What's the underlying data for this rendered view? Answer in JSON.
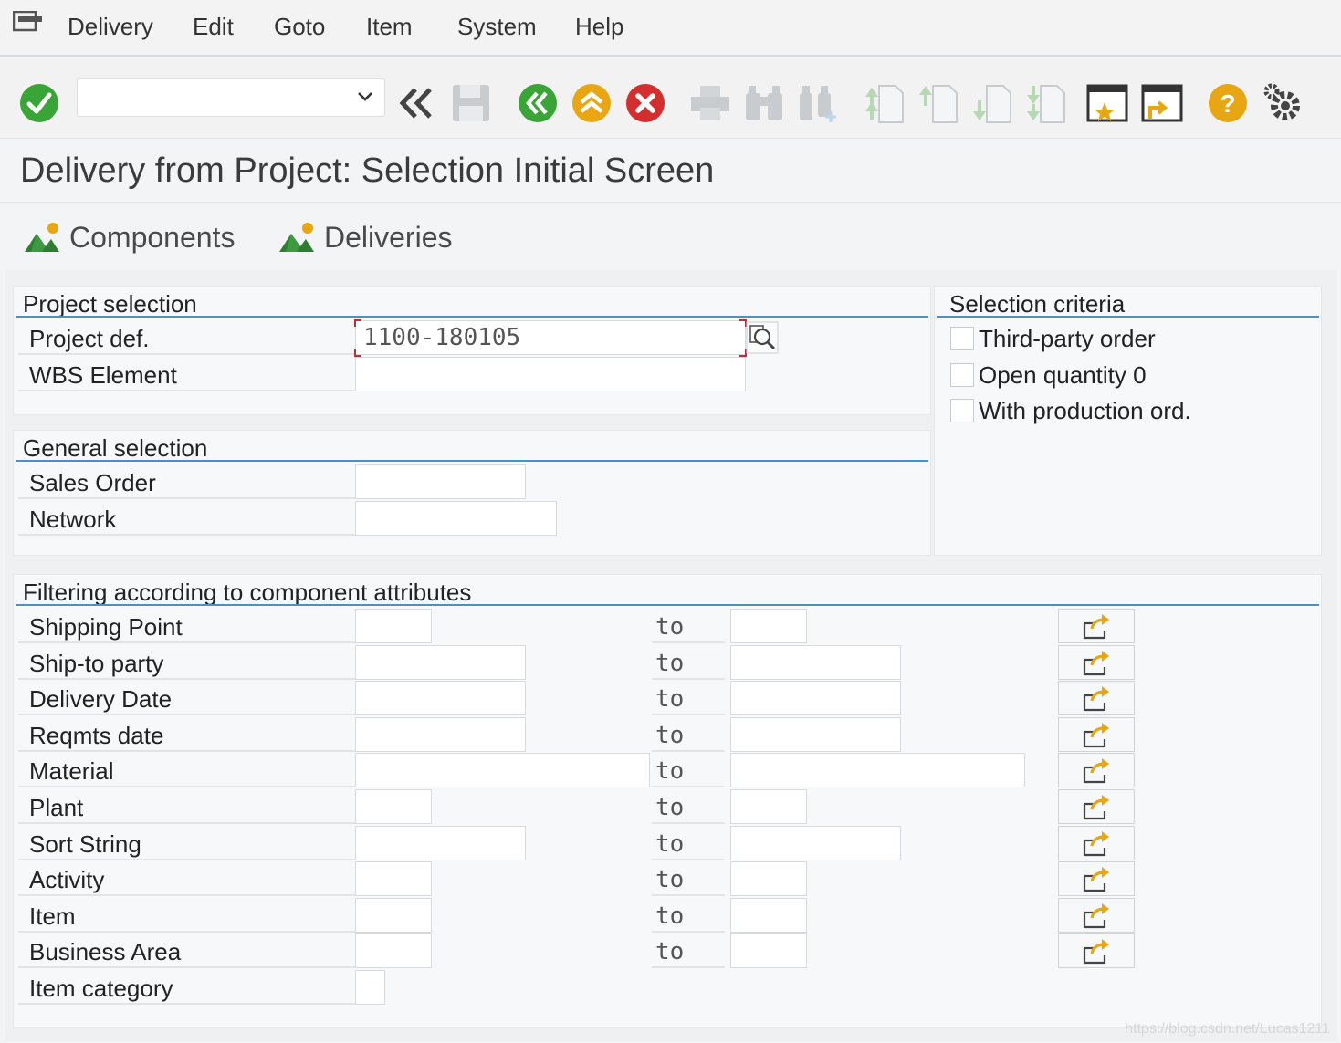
{
  "menu": {
    "items": [
      "Delivery",
      "Edit",
      "Goto",
      "Item",
      "System",
      "Help"
    ]
  },
  "toolbar": {
    "command_value": "",
    "icons": [
      "enter-icon",
      "command-dropdown-icon",
      "back-double-icon",
      "save-icon",
      "back-icon",
      "exit-icon",
      "cancel-icon",
      "print-icon",
      "find-icon",
      "find-next-icon",
      "first-page-icon",
      "previous-page-icon",
      "next-page-icon",
      "last-page-icon",
      "create-session-icon",
      "shortcut-icon",
      "help-icon",
      "settings-icon"
    ],
    "colors": {
      "green": "#3aa537",
      "yellow": "#e8a712",
      "red": "#d32f2f"
    }
  },
  "title": "Delivery from Project: Selection Initial Screen",
  "app_toolbar": {
    "components_label": "Components",
    "deliveries_label": "Deliveries"
  },
  "project_selection": {
    "title": "Project selection",
    "project_def_label": "Project def.",
    "project_def_value": "1100-180105",
    "wbs_label": "WBS Element",
    "wbs_value": ""
  },
  "general_selection": {
    "title": "General selection",
    "sales_order_label": "Sales Order",
    "network_label": "Network"
  },
  "selection_criteria": {
    "title": "Selection criteria",
    "options": [
      {
        "label": "Third-party order",
        "checked": false
      },
      {
        "label": "Open quantity 0",
        "checked": false
      },
      {
        "label": "With production ord.",
        "checked": false
      }
    ]
  },
  "filtering": {
    "title": "Filtering according to component attributes",
    "to_label": "to",
    "rows": [
      {
        "label": "Shipping Point"
      },
      {
        "label": "Ship-to party"
      },
      {
        "label": "Delivery Date"
      },
      {
        "label": "Reqmts date"
      },
      {
        "label": "Material"
      },
      {
        "label": "Plant"
      },
      {
        "label": "Sort String"
      },
      {
        "label": "Activity"
      },
      {
        "label": "Item"
      },
      {
        "label": "Business Area"
      }
    ],
    "item_category_label": "Item category"
  },
  "watermark": "https://blog.csdn.net/Lucas1211"
}
